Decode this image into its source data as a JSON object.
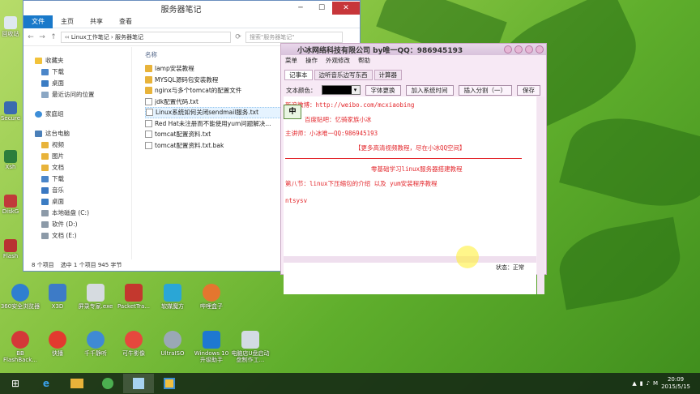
{
  "explorer": {
    "title": "服务器笔记",
    "ribbon_tabs": [
      "文件",
      "主页",
      "共享",
      "查看"
    ],
    "path": [
      "Linux工作笔记",
      "服务器笔记"
    ],
    "search_placeholder": "搜索\"服务器笔记\"",
    "nav": [
      {
        "label": "收藏夹",
        "type": "star"
      },
      {
        "label": "下载",
        "type": "folder"
      },
      {
        "label": "桌面",
        "type": "desktop"
      },
      {
        "label": "最近访问的位置",
        "type": "recent"
      },
      {
        "label": "家庭组",
        "type": "group"
      },
      {
        "label": "这台电脑",
        "type": "pc"
      },
      {
        "label": "视频",
        "type": "folder"
      },
      {
        "label": "图片",
        "type": "folder"
      },
      {
        "label": "文档",
        "type": "folder"
      },
      {
        "label": "下载",
        "type": "folder"
      },
      {
        "label": "音乐",
        "type": "folder"
      },
      {
        "label": "桌面",
        "type": "folder"
      },
      {
        "label": "本地磁盘 (C:)",
        "type": "drive"
      },
      {
        "label": "软件 (D:)",
        "type": "drive"
      },
      {
        "label": "文档 (E:)",
        "type": "drive"
      }
    ],
    "column_name": "名称",
    "files": [
      {
        "name": "lamp安装教程",
        "type": "folder"
      },
      {
        "name": "MYSQL源码包安装教程",
        "type": "folder"
      },
      {
        "name": "nginx与多个tomcat的配置文件",
        "type": "folder"
      },
      {
        "name": "jdk配置代码.txt",
        "type": "doc"
      },
      {
        "name": "Linux系统如何关闭sendmail服务.txt",
        "type": "doc",
        "selected": true
      },
      {
        "name": "Red Hat未注册而不能使用yum问题解决...",
        "type": "doc"
      },
      {
        "name": "tomcat配置资料.txt",
        "type": "doc"
      },
      {
        "name": "tomcat配置资料.txt.bak",
        "type": "doc"
      }
    ],
    "status_count": "8 个项目",
    "status_selected": "选中 1 个项目  945 字节"
  },
  "notes": {
    "title": "小冰网络科技有限公司 by唯一QQ：986945193",
    "menu": [
      "菜单",
      "操作",
      "外观修改",
      "帮助"
    ],
    "tabs": [
      "记事本",
      "边听音乐边写东西",
      "计算器"
    ],
    "toolbar": {
      "color_label": "文本颜色：",
      "btn_font": "字体更换",
      "btn_time": "加入系统时间",
      "btn_split": "插入分割（一）",
      "btn_save": "保存"
    },
    "lines": [
      "新浪微博：http://weibo.com/mcxiaobing",
      "百度贴吧：忆骑家族小冰",
      "主讲师：小冰唯一QQ:986945193",
      "【更多高清视频教程，尽在小冰QQ空间】",
      "零基础学习linux服务器搭建教程",
      "第八节：linux下压缩包的介绍   以及 yum安装程序教程",
      "ntsysv"
    ],
    "ime_char": "中",
    "status": "状态：正常"
  },
  "desktop": {
    "left_icons": [
      "回收站",
      "Secure",
      "Xsh",
      "DiskG",
      "Flash"
    ],
    "icons_row1": [
      "360安全浏览器",
      "X3D",
      "屏录专家.exe",
      "PacketTra...",
      "软媒魔方",
      "哔哩盒子"
    ],
    "icons_row2": [
      "BB FlashBack...",
      "快播",
      "千千静听",
      "可牛影像",
      "UltraISO",
      "Windows 10 升级助手",
      "电脑店U盘启动盘制作工..."
    ]
  },
  "taskbar": {
    "clock_time": "20:09",
    "clock_date": "2015/5/15",
    "ime": "M"
  }
}
